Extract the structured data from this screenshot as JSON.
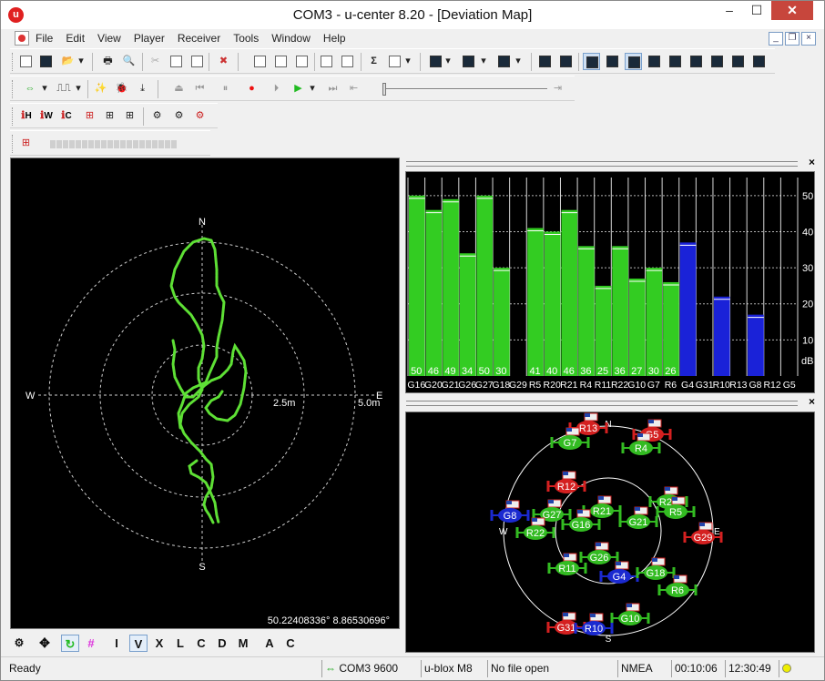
{
  "window": {
    "title": "COM3 - u-center 8.20 - [Deviation Map]",
    "minimize": "–",
    "maximize": "☐",
    "close": "✕"
  },
  "menu": [
    "File",
    "Edit",
    "View",
    "Player",
    "Receiver",
    "Tools",
    "Window",
    "Help"
  ],
  "toolbar2": {
    "signal_labels": [
      "H",
      "W",
      "C"
    ]
  },
  "deviation_map": {
    "north": "N",
    "south": "S",
    "east": "E",
    "west": "W",
    "ring_inner_label": "2.5m",
    "ring_outer_label": "5.0m",
    "coordinates": "50.22408336° 8.86530696°",
    "track_color": "#5ee035"
  },
  "carrier_noise": {
    "axis_unit": "dB",
    "y_ticks": [
      "50",
      "40",
      "30",
      "20",
      "10"
    ]
  },
  "chart_data": {
    "type": "bar",
    "ylim": [
      0,
      55
    ],
    "categories": [
      "G16",
      "G20",
      "G21",
      "G26",
      "G27",
      "G18",
      "G29",
      "R5",
      "R20",
      "R21",
      "R4",
      "R11",
      "R22",
      "G10",
      "G7",
      "R6",
      "G4",
      "G31",
      "R10",
      "R13",
      "G8",
      "R12",
      "G5"
    ],
    "values": [
      50,
      46,
      49,
      34,
      50,
      30,
      null,
      41,
      40,
      46,
      36,
      25,
      36,
      27,
      30,
      26,
      37,
      null,
      22,
      null,
      17,
      null,
      null
    ],
    "value_labels": [
      "50",
      "46",
      "49",
      "34",
      "50",
      "30",
      "",
      "41",
      "40",
      "46",
      "36",
      "25",
      "36",
      "27",
      "30",
      "26",
      "",
      "",
      "",
      "",
      "",
      "",
      ""
    ],
    "status": [
      "used",
      "used",
      "used",
      "used",
      "used",
      "used",
      "none",
      "used",
      "used",
      "used",
      "used",
      "used",
      "used",
      "used",
      "used",
      "used",
      "unused",
      "none",
      "unused",
      "none",
      "unused",
      "none",
      "none"
    ],
    "colors": {
      "used": "#33cc22",
      "unused": "#1a22d8"
    }
  },
  "sky_view": {
    "north": "N",
    "south": "S",
    "east": "E",
    "west": "W",
    "satellites": [
      {
        "id": "R13",
        "az_el": "R",
        "status": "red"
      },
      {
        "id": "G5",
        "status": "red"
      },
      {
        "id": "G7",
        "status": "green"
      },
      {
        "id": "R4",
        "status": "green"
      },
      {
        "id": "R12",
        "status": "red"
      },
      {
        "id": "R20",
        "status": "green"
      },
      {
        "id": "R5",
        "status": "green"
      },
      {
        "id": "G8",
        "status": "blue"
      },
      {
        "id": "G27",
        "status": "green"
      },
      {
        "id": "R21",
        "status": "green"
      },
      {
        "id": "G16",
        "status": "green"
      },
      {
        "id": "G21",
        "status": "green"
      },
      {
        "id": "R22",
        "status": "green"
      },
      {
        "id": "G29",
        "status": "red"
      },
      {
        "id": "G26",
        "status": "green"
      },
      {
        "id": "R11",
        "status": "green"
      },
      {
        "id": "G4",
        "status": "blue"
      },
      {
        "id": "G18",
        "status": "green"
      },
      {
        "id": "R6",
        "status": "green"
      },
      {
        "id": "G10",
        "status": "green"
      },
      {
        "id": "G31",
        "status": "red"
      },
      {
        "id": "R10",
        "status": "blue"
      }
    ]
  },
  "bottom_toolbar": [
    "I",
    "V",
    "X",
    "L",
    "C",
    "D",
    "M",
    "A",
    "C"
  ],
  "statusbar": {
    "ready": "Ready",
    "port": "COM3 9600",
    "receiver": "u-blox M8",
    "file": "No file open",
    "protocol": "NMEA",
    "elapsed": "00:10:06",
    "clock": "12:30:49"
  }
}
